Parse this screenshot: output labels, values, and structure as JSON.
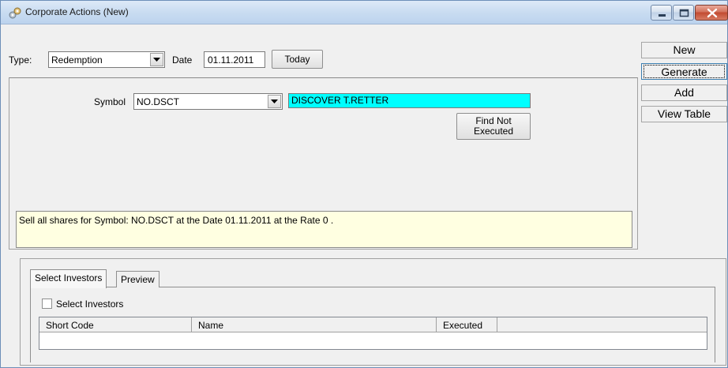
{
  "window": {
    "title": "Corporate Actions (New)"
  },
  "form": {
    "type_label": "Type:",
    "type_value": "Redemption",
    "date_label": "Date",
    "date_value": "01.11.2011",
    "today_button": "Today",
    "symbol_label": "Symbol",
    "symbol_value": "NO.DSCT",
    "symbol_description": "DISCOVER T.RETTER",
    "find_button_line1": "Find Not",
    "find_button_line2": "Executed",
    "message": "Sell all shares for Symbol: NO.DSCT at the Date 01.11.2011 at the Rate 0 ."
  },
  "side_buttons": {
    "new": "New",
    "generate": "Generate",
    "add": "Add",
    "view_table": "View Table"
  },
  "tabs": [
    {
      "label": "Select Investors",
      "active": true
    },
    {
      "label": "Preview",
      "active": false
    }
  ],
  "investors": {
    "checkbox_label": "Select Investors",
    "checked": false,
    "columns": [
      "Short Code",
      "Name",
      "Executed"
    ]
  },
  "colors": {
    "description_bg": "#00ffff",
    "message_bg": "#ffffe1"
  },
  "icons": {
    "app": "corporate-actions-icon",
    "minimize": "minimize-icon",
    "maximize": "maximize-icon",
    "close": "close-icon",
    "dropdown": "chevron-down-icon"
  }
}
